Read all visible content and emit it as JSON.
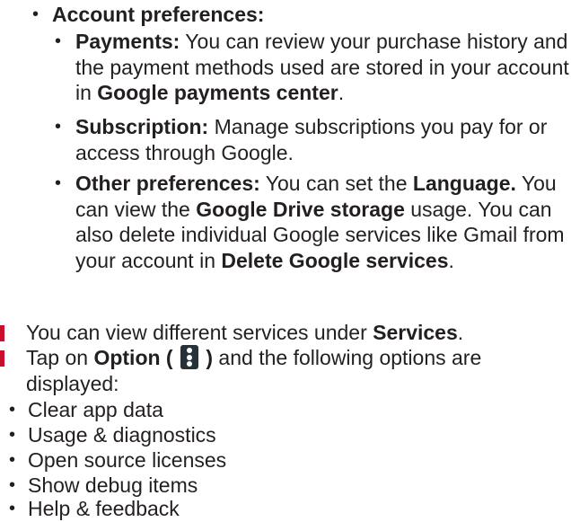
{
  "account_preferences": {
    "title": "Account preferences:",
    "payments": {
      "label": "Payments:",
      "text_1": " You can review your purchase history and the payment methods used are stored in your account in ",
      "link": "Google payments center",
      "text_2": "."
    },
    "subscription": {
      "label": "Subscription:",
      "text": " Manage subscriptions you pay for or access through Google."
    },
    "other": {
      "label": "Other preferences:",
      "text_1": " You can set the ",
      "language": "Language.",
      "text_2": " You can view the ",
      "storage": "Google Drive storage",
      "text_3": " usage. You can also delete individual Google services like Gmail from your account in ",
      "delete": "Delete Google services",
      "text_4": "."
    }
  },
  "step_services": {
    "text_1": "You can view different services under ",
    "services": "Services",
    "text_2": "."
  },
  "step_option": {
    "text_1": "Tap on ",
    "option": "Option (",
    "option_close": ")",
    "text_2": " and the following options are displayed:",
    "icon": "more-vert-icon"
  },
  "options": [
    "Clear app data",
    "Usage & diagnostics",
    "Open source licenses",
    "Show debug items",
    "Help & feedback"
  ],
  "colors": {
    "text": "#231f20",
    "marker": "#c8102e",
    "icon_bg": "#263238"
  }
}
